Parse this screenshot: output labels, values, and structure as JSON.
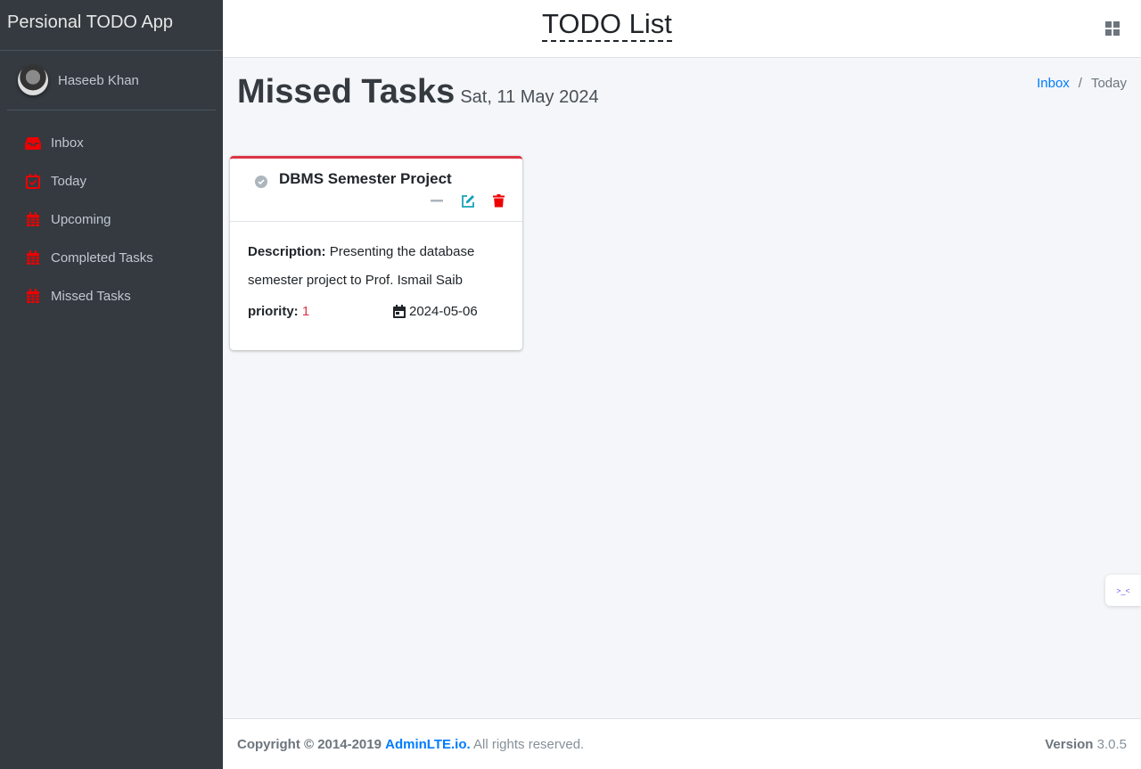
{
  "sidebar": {
    "brand": "Persional TODO App",
    "user": "Haseeb Khan",
    "items": [
      {
        "label": "Inbox",
        "icon": "inbox-icon"
      },
      {
        "label": "Today",
        "icon": "calendar-check-icon"
      },
      {
        "label": "Upcoming",
        "icon": "calendar-icon"
      },
      {
        "label": "Completed Tasks",
        "icon": "calendar-icon"
      },
      {
        "label": "Missed Tasks",
        "icon": "calendar-icon"
      }
    ],
    "icon_color": "#ff0000"
  },
  "header": {
    "title": "TODO List",
    "grid_icon": "grid-icon"
  },
  "page": {
    "title": "Missed Tasks",
    "date": "Sat, 11 May 2024",
    "breadcrumb": [
      "Inbox",
      "Today"
    ]
  },
  "task": {
    "title": "DBMS Semester Project",
    "description_label": "Description:",
    "description": "Presenting the database semester project to Prof. Ismail Saib",
    "priority_label": "priority:",
    "priority": "1",
    "due_date": "2024-05-06",
    "border_color": "#dc3545"
  },
  "footer": {
    "copyright": "Copyright © 2014-2019",
    "link": "AdminLTE.io.",
    "rights": "All rights reserved.",
    "version_label": "Version",
    "version": "3.0.5"
  }
}
